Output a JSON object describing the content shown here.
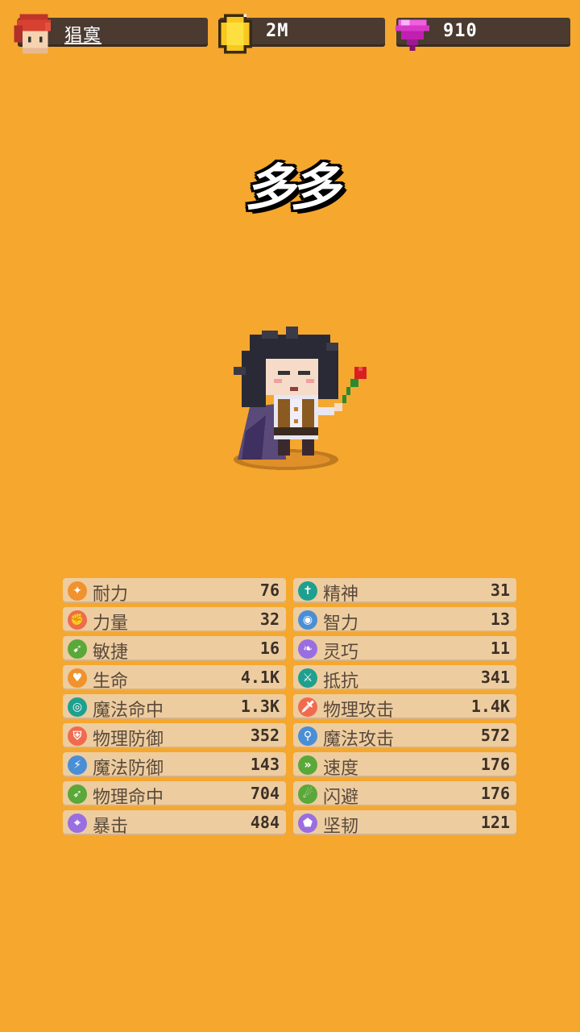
{
  "resources": {
    "player": {
      "name": "猖寞",
      "icon": "avatar-icon"
    },
    "gold": {
      "value": "2M",
      "icon": "gold-coin-icon"
    },
    "gems": {
      "value": "910",
      "icon": "gem-icon"
    }
  },
  "hero": {
    "name": "多多"
  },
  "stats_left": [
    {
      "label": "耐力",
      "value": "76",
      "icon": "stamina-icon",
      "color": "#f0922e"
    },
    {
      "label": "力量",
      "value": "32",
      "icon": "strength-icon",
      "color": "#f06b4e"
    },
    {
      "label": "敏捷",
      "value": "16",
      "icon": "agility-icon",
      "color": "#5aa83a"
    },
    {
      "label": "生命",
      "value": "4.1K",
      "icon": "heart-icon",
      "color": "#f0922e"
    },
    {
      "label": "魔法命中",
      "value": "1.3K",
      "icon": "magic-hit-icon",
      "color": "#1fa08e"
    },
    {
      "label": "物理防御",
      "value": "352",
      "icon": "physical-defense-icon",
      "color": "#f06b4e"
    },
    {
      "label": "魔法防御",
      "value": "143",
      "icon": "magic-defense-icon",
      "color": "#4a8fd6"
    },
    {
      "label": "物理命中",
      "value": "704",
      "icon": "physical-hit-icon",
      "color": "#5aa83a"
    },
    {
      "label": "暴击",
      "value": "484",
      "icon": "crit-icon",
      "color": "#9a6ee0"
    }
  ],
  "stats_right": [
    {
      "label": "精神",
      "value": "31",
      "icon": "spirit-icon",
      "color": "#1fa08e"
    },
    {
      "label": "智力",
      "value": "13",
      "icon": "intellect-icon",
      "color": "#4a8fd6"
    },
    {
      "label": "灵巧",
      "value": "11",
      "icon": "dexterity-icon",
      "color": "#9a6ee0"
    },
    {
      "label": "抵抗",
      "value": "341",
      "icon": "resist-icon",
      "color": "#1fa08e"
    },
    {
      "label": "物理攻击",
      "value": "1.4K",
      "icon": "physical-attack-icon",
      "color": "#f06b4e"
    },
    {
      "label": "魔法攻击",
      "value": "572",
      "icon": "magic-attack-icon",
      "color": "#4a8fd6"
    },
    {
      "label": "速度",
      "value": "176",
      "icon": "speed-icon",
      "color": "#5aa83a"
    },
    {
      "label": "闪避",
      "value": "176",
      "icon": "dodge-icon",
      "color": "#5aa83a"
    },
    {
      "label": "坚韧",
      "value": "121",
      "icon": "toughness-icon",
      "color": "#9a6ee0"
    }
  ]
}
